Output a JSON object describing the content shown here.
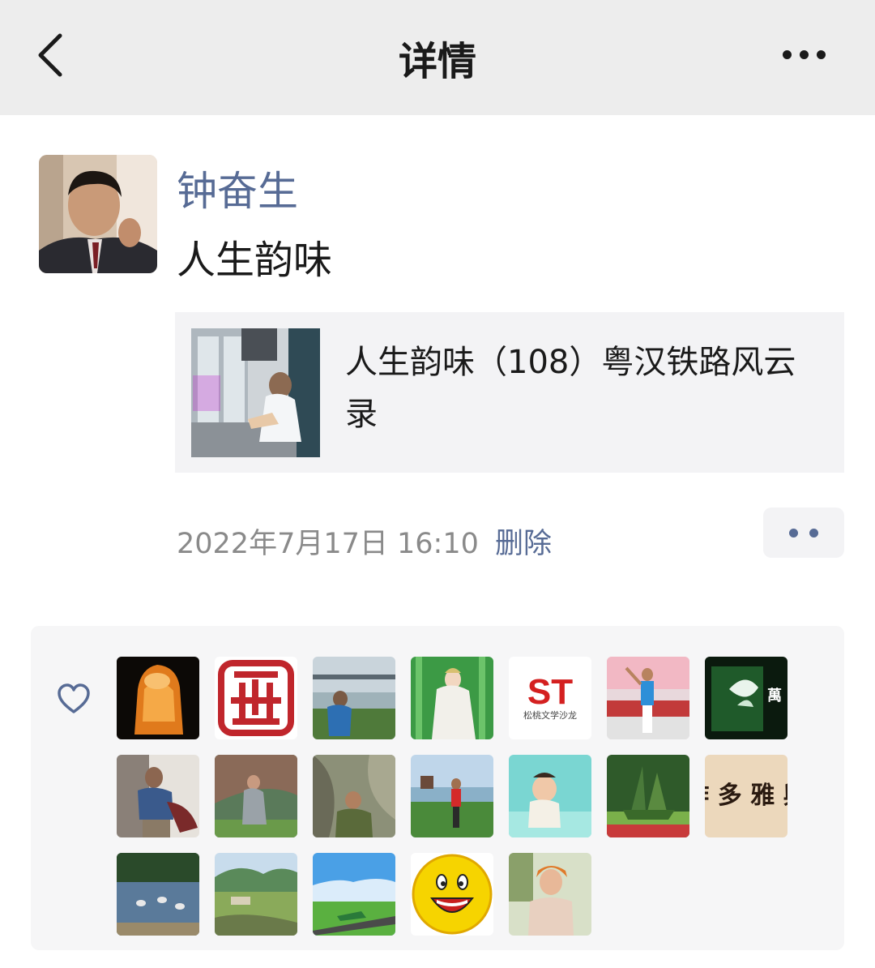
{
  "nav": {
    "title": "详情"
  },
  "post": {
    "author": "钟奋生",
    "text": "人生韵味",
    "link": {
      "title": "人生韵味（108）粤汉铁路风云录"
    },
    "timestamp": "2022年7月17日 16:10",
    "delete_label": "删除"
  },
  "likes": {
    "icon": "heart-icon",
    "avatars": [
      "liker-1",
      "liker-2",
      "liker-3",
      "liker-4",
      "liker-5",
      "liker-6",
      "liker-7",
      "liker-8",
      "liker-9",
      "liker-10",
      "liker-11",
      "liker-12",
      "liker-13",
      "liker-14",
      "liker-15",
      "liker-16",
      "liker-17",
      "liker-18",
      "liker-19"
    ],
    "avatar_texts": {
      "liker-5": "ST",
      "liker-5-sub": "松桃文学沙龙",
      "liker-7": "萬",
      "liker-14": "作 多 雅 興"
    }
  },
  "colors": {
    "link_blue": "#576b95",
    "navbar_bg": "#ededed",
    "card_bg": "#f3f3f5"
  }
}
